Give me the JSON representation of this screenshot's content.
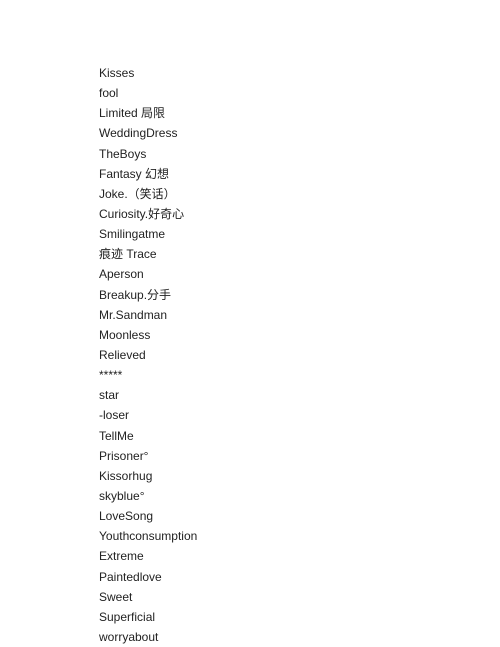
{
  "items": [
    "Kisses",
    "fool",
    "Limited 局限",
    "WeddingDress",
    "TheBoys",
    "Fantasy 幻想",
    "Joke.（笑话）",
    "Curiosity.好奇心",
    "Smilingatme",
    "痕迹 Trace",
    "Aperson",
    "Breakup.分手",
    "Mr.Sandman",
    "Moonless",
    "Relieved",
    "*****",
    "star",
    "-loser",
    "TellMe",
    "Prisoner°",
    "Kissorhug",
    "skyblue°",
    "LoveSong",
    "Youthconsumption",
    "Extreme",
    "Paintedlove",
    "Sweet",
    "Superficial",
    "worryabout"
  ]
}
